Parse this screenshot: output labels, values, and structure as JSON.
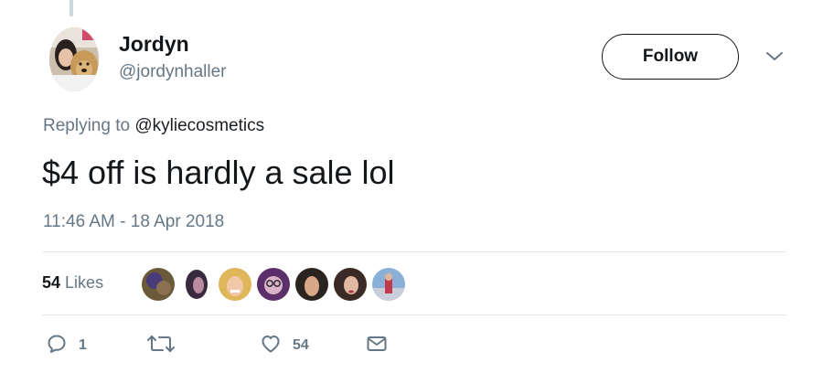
{
  "tweet": {
    "author": {
      "display_name": "Jordyn",
      "handle": "@jordynhaller"
    },
    "follow_label": "Follow",
    "reply_prefix": "Replying to",
    "reply_mention": "@kyliecosmetics",
    "text": "$4 off is hardly a sale lol",
    "timestamp": "11:46 AM - 18 Apr 2018"
  },
  "stats": {
    "likes_count": "54",
    "likes_label": "Likes",
    "liker_avatar_count": 7
  },
  "actions": {
    "reply_count": "1",
    "retweet_count": "",
    "like_count": "54"
  },
  "icons": {
    "more": "chevron-down-icon",
    "reply": "reply-icon",
    "retweet": "retweet-icon",
    "like": "heart-icon",
    "dm": "envelope-icon"
  },
  "colors": {
    "text": "#14171a",
    "secondary": "#657786",
    "divider": "#e1e8ed"
  }
}
